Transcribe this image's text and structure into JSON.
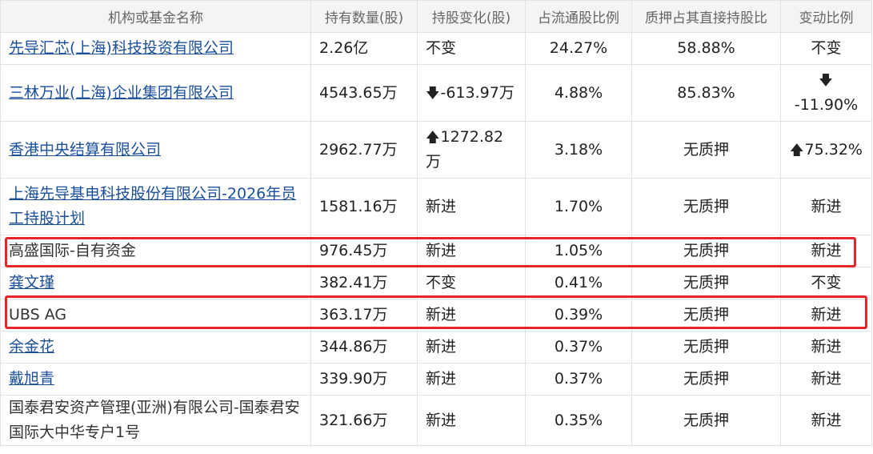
{
  "table": {
    "headers": [
      "机构或基金名称",
      "持有数量(股)",
      "持股变化(股)",
      "占流通股比例",
      "质押占其直接持股比",
      "变动比例"
    ],
    "rows": [
      {
        "name": "先导汇芯(上海)科技投资有限公司",
        "name_is_link": true,
        "quantity": "2.26亿",
        "change": "不变",
        "change_dir": "none",
        "float_pct": "24.27%",
        "pledge": "58.88%",
        "ratio": "不变",
        "ratio_dir": "none"
      },
      {
        "name": "三林万业(上海)企业集团有限公司",
        "name_is_link": true,
        "quantity": "4543.65万",
        "change": "-613.97万",
        "change_dir": "down",
        "float_pct": "4.88%",
        "pledge": "85.83%",
        "ratio": "-11.90%",
        "ratio_dir": "down"
      },
      {
        "name": "香港中央结算有限公司",
        "name_is_link": true,
        "quantity": "2962.77万",
        "change": "1272.82万",
        "change_dir": "up",
        "float_pct": "3.18%",
        "pledge": "无质押",
        "ratio": "75.32%",
        "ratio_dir": "up"
      },
      {
        "name": "上海先导基电科技股份有限公司-2026年员工持股计划",
        "name_is_link": true,
        "quantity": "1581.16万",
        "change": "新进",
        "change_dir": "new",
        "float_pct": "1.70%",
        "pledge": "无质押",
        "ratio": "新进",
        "ratio_dir": "new"
      },
      {
        "name": "高盛国际-自有资金",
        "name_is_link": false,
        "quantity": "976.45万",
        "change": "新进",
        "change_dir": "new",
        "float_pct": "1.05%",
        "pledge": "无质押",
        "ratio": "新进",
        "ratio_dir": "new"
      },
      {
        "name": "龚文瑾",
        "name_is_link": true,
        "quantity": "382.41万",
        "change": "不变",
        "change_dir": "none",
        "float_pct": "0.41%",
        "pledge": "无质押",
        "ratio": "不变",
        "ratio_dir": "none"
      },
      {
        "name": "UBS AG",
        "name_is_link": false,
        "quantity": "363.17万",
        "change": "新进",
        "change_dir": "new",
        "float_pct": "0.39%",
        "pledge": "无质押",
        "ratio": "新进",
        "ratio_dir": "new"
      },
      {
        "name": "余金花",
        "name_is_link": true,
        "quantity": "344.86万",
        "change": "新进",
        "change_dir": "new",
        "float_pct": "0.37%",
        "pledge": "无质押",
        "ratio": "新进",
        "ratio_dir": "new"
      },
      {
        "name": "戴旭青",
        "name_is_link": true,
        "quantity": "339.90万",
        "change": "新进",
        "change_dir": "new",
        "float_pct": "0.37%",
        "pledge": "无质押",
        "ratio": "新进",
        "ratio_dir": "new"
      },
      {
        "name": "国泰君安资产管理(亚洲)有限公司-国泰君安国际大中华专户1号",
        "name_is_link": false,
        "quantity": "321.66万",
        "change": "新进",
        "change_dir": "new",
        "float_pct": "0.35%",
        "pledge": "无质押",
        "ratio": "新进",
        "ratio_dir": "new"
      }
    ]
  },
  "highlighted_rows": [
    4,
    6
  ],
  "colors": {
    "link": "#1a4f9c",
    "up": "#c9161b",
    "down": "#2e9a28",
    "highlight_box": "#e8232a",
    "header_bg": "#f4f4f4",
    "border": "#e2e2e2"
  },
  "icons": {
    "up": "arrow-up-icon",
    "down": "arrow-down-icon"
  }
}
